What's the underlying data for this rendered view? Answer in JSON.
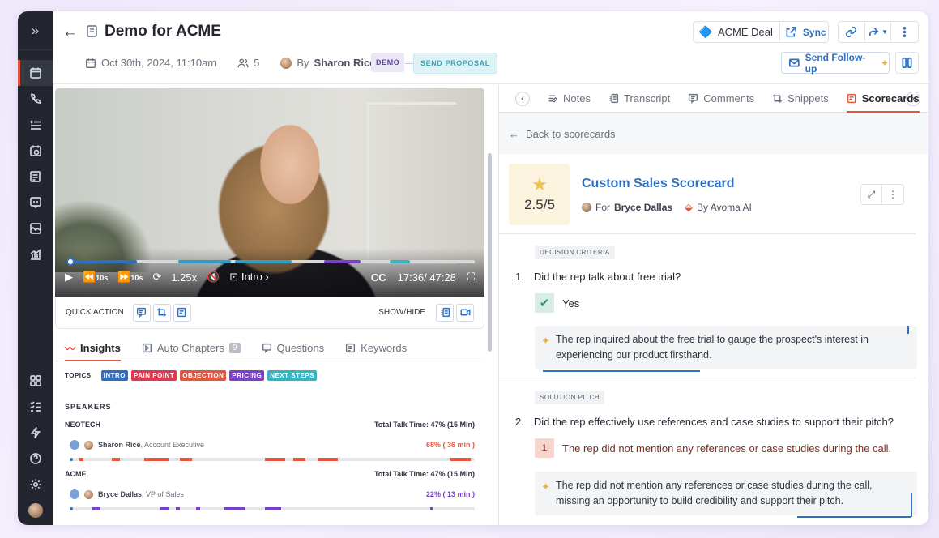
{
  "header": {
    "title": "Demo for ACME",
    "date": "Oct 30th, 2024, 11:10am",
    "attendees": "5",
    "by_prefix": "By",
    "host": "Sharon Rice",
    "tags": [
      "DEMO",
      "SEND PROPOSAL"
    ],
    "crm_label": "ACME Deal",
    "sync_label": "Sync",
    "followup_label": "Send Follow-up"
  },
  "video": {
    "speed": "1.25x",
    "chapter": "Intro",
    "cc": "CC",
    "time": "17:36/ 47:28",
    "skip_back": "10s",
    "skip_fwd": "10s",
    "progress_segments": [
      {
        "start": 0.0,
        "end": 0.17,
        "color": "#2f6fbf"
      },
      {
        "start": 0.27,
        "end": 0.4,
        "color": "#2f9ec7"
      },
      {
        "start": 0.41,
        "end": 0.55,
        "color": "#2f9ec7"
      },
      {
        "start": 0.63,
        "end": 0.72,
        "color": "#7b3fc9"
      },
      {
        "start": 0.79,
        "end": 0.84,
        "color": "#33b6c3"
      }
    ]
  },
  "quick_action": {
    "label": "QUICK ACTION",
    "show_hide": "SHOW/HIDE"
  },
  "left_tabs": [
    {
      "label": "Insights",
      "active": true
    },
    {
      "label": "Auto Chapters",
      "badge": "9"
    },
    {
      "label": "Questions"
    },
    {
      "label": "Keywords"
    }
  ],
  "topics": {
    "label": "TOPICS",
    "items": [
      {
        "label": "INTRO",
        "color": "#2f6fbf"
      },
      {
        "label": "PAIN POINT",
        "color": "#e0384f"
      },
      {
        "label": "OBJECTION",
        "color": "#e2563d"
      },
      {
        "label": "PRICING",
        "color": "#7b3fc9"
      },
      {
        "label": "NEXT STEPS",
        "color": "#33b6c3"
      }
    ]
  },
  "speakers": {
    "label": "SPEAKERS",
    "groups": [
      {
        "org": "NEOTECH",
        "talk_time": "Total Talk Time: 47% (15 Min)",
        "name": "Sharon Rice",
        "role": ", Account Executive",
        "pct": "68% ( 36 min )",
        "color": "#e2563d",
        "segments": [
          [
            0.02,
            0.03
          ],
          [
            0.1,
            0.12
          ],
          [
            0.18,
            0.24
          ],
          [
            0.27,
            0.3
          ],
          [
            0.48,
            0.53
          ],
          [
            0.55,
            0.58
          ],
          [
            0.61,
            0.66
          ],
          [
            0.94,
            0.99
          ]
        ]
      },
      {
        "org": "ACME",
        "talk_time": "Total Talk Time: 47% (15 Min)",
        "name": "Bryce Dallas",
        "role": ", VP of Sales",
        "pct": "22% ( 13 min )",
        "color": "#7b3fc9",
        "segments": [
          [
            0.05,
            0.07
          ],
          [
            0.22,
            0.24
          ],
          [
            0.26,
            0.27
          ],
          [
            0.31,
            0.32
          ],
          [
            0.38,
            0.43
          ],
          [
            0.48,
            0.52
          ],
          [
            0.89,
            0.895
          ]
        ]
      }
    ]
  },
  "right_tabs": [
    {
      "label": "Notes"
    },
    {
      "label": "Transcript"
    },
    {
      "label": "Comments"
    },
    {
      "label": "Snippets"
    },
    {
      "label": "Scorecards",
      "active": true
    }
  ],
  "scorecard": {
    "back_label": "Back to scorecards",
    "score": "2.5/5",
    "title": "Custom Sales Scorecard",
    "for_prefix": "For",
    "for_name": "Bryce Dallas",
    "by_label": "By Avoma AI",
    "sections": [
      {
        "tag": "DECISION CRITERIA",
        "num": "1.",
        "question": "Did the rep talk about free trial?",
        "answer": "Yes",
        "ai_note": "The rep inquired about the free trial to gauge the prospect's interest in experiencing our product firsthand."
      },
      {
        "tag": "SOLUTION PITCH",
        "num": "2.",
        "question": "Did the rep effectively use references and case studies to support their pitch?",
        "answer_num": "1",
        "answer": "The rep did not mention any references or case studies during the call.",
        "ai_note": "The rep did not mention any references or case studies during the call, missing an opportunity to build credibility and support their pitch."
      }
    ]
  }
}
